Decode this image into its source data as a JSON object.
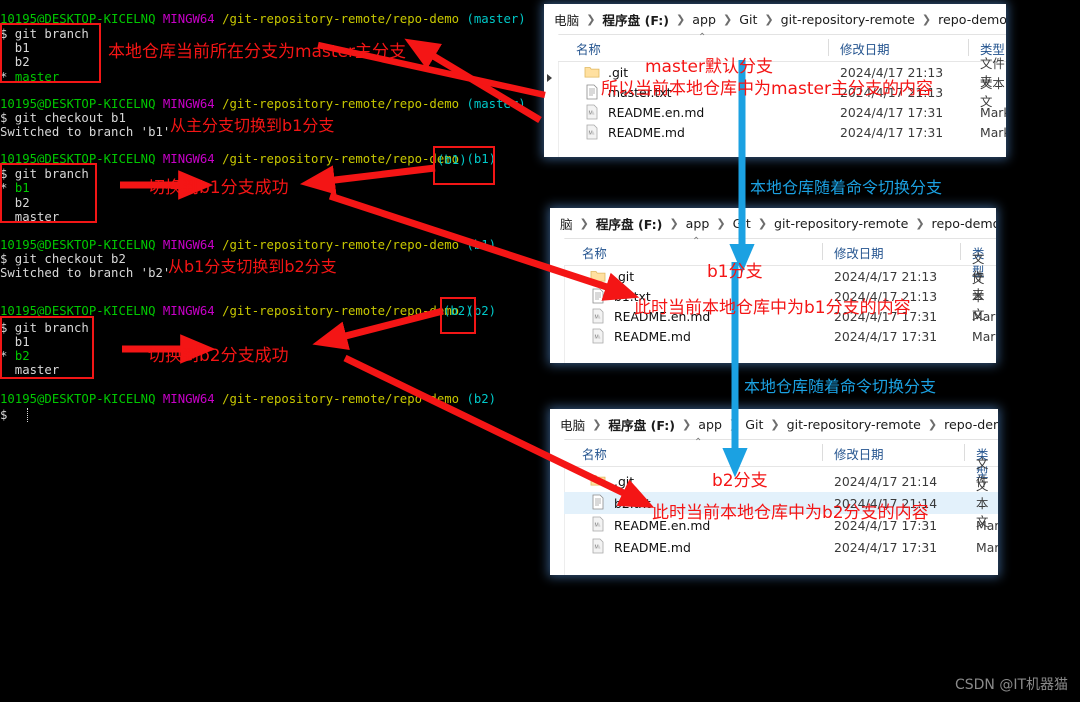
{
  "terminal": {
    "prompt_user": "10195@DESKTOP-KICELNQ",
    "prompt_host": "MINGW64",
    "prompt_path": "/git-repository-remote/repo-demo",
    "blocks": [
      {
        "branch": "(master)",
        "command": "$ git branch",
        "output": [
          "  b1",
          "  b2",
          "* master"
        ],
        "current": "master"
      },
      {
        "branch": "(master)",
        "command": "$ git checkout b1",
        "output": [
          "Switched to branch 'b1'"
        ],
        "current": ""
      },
      {
        "branch": "(b1)",
        "command": "$ git branch",
        "output": [
          "* b1",
          "  b2",
          "  master"
        ],
        "current": "b1"
      },
      {
        "branch": "(b1)",
        "command": "$ git checkout b2",
        "output": [
          "Switched to branch 'b2'"
        ],
        "current": ""
      },
      {
        "branch": "(b2)",
        "command": "$ git branch",
        "output": [
          "  b1",
          "* b2",
          "  master"
        ],
        "current": "b2"
      },
      {
        "branch": "(b2)",
        "command": "$",
        "output": [],
        "current": ""
      }
    ],
    "lines": [
      "10195@DESKTOP-KICELNQ MINGW64 /git-repository-remote/repo-demo (master)",
      "$ git branch",
      "  b1",
      "  b2",
      "* master",
      "10195@DESKTOP-KICELNQ MINGW64 /git-repository-remote/repo-demo (master)",
      "$ git checkout b1",
      "Switched to branch 'b1'",
      "10195@DESKTOP-KICELNQ MINGW64 /git-repository-remote/repo-demo (b1)",
      "$ git branch",
      "* b1",
      "  b2",
      "  master",
      "10195@DESKTOP-KICELNQ MINGW64 /git-repository-remote/repo-demo (b1)",
      "$ git checkout b2",
      "Switched to branch 'b2'",
      "10195@DESKTOP-KICELNQ MINGW64 /git-repository-remote/repo-demo (b2)",
      "$ git branch",
      "  b1",
      "* b2",
      "  master",
      "10195@DESKTOP-KICELNQ MINGW64 /git-repository-remote/repo-demo (b2)",
      "$"
    ],
    "line_texts": {
      "t0_user": "10195@DESKTOP-KICELNQ",
      "t0_host": "MINGW64",
      "t0_path": "/git-repository-remote/repo-demo",
      "t0_branch": "(master)",
      "t1": "$ git branch",
      "t2": "  b1",
      "t3": "  b2",
      "t4_star": "* ",
      "t4_name": "master",
      "t5_branch": "(master)",
      "t6": "$ git checkout b1",
      "t7": "Switched to branch 'b1'",
      "t8_branch": "(b1)",
      "t9": "$ git branch",
      "t10_star": "* ",
      "t10_name": "b1",
      "t11": "  b2",
      "t12": "  master",
      "t13_branch": "(b1)",
      "t14": "$ git checkout b2",
      "t15": "Switched to branch 'b2'",
      "t16_branch": "(b2)",
      "t17": "$ git branch",
      "t18": "  b1",
      "t19_star": "* ",
      "t19_name": "b2",
      "t20": "  master",
      "t21_branch": "(b2)",
      "t22": "$"
    }
  },
  "annotations": {
    "red": [
      "本地仓库当前所在分支为master主分支",
      "从主分支切换到b1分支",
      "切换到b1分支成功",
      "从b1分支切换到b2分支",
      "切换到b2分支成功"
    ],
    "explorer_red": [
      "master默认分支",
      "所以当前本地仓库中为master主分支的内容",
      "b1分支",
      "此时当前本地仓库中为b1分支的内容",
      "b2分支",
      "此时当前本地仓库中为b2分支的内容"
    ],
    "blue": [
      "本地仓库随着命令切换分支",
      "本地仓库随着命令切换分支"
    ],
    "boxed_branch_1": "(b1)",
    "boxed_branch_2": "(b2)"
  },
  "explorers": [
    {
      "breadcrumb": [
        "电脑",
        "程序盘 (F:)",
        "app",
        "Git",
        "git-repository-remote",
        "repo-demo"
      ],
      "columns": {
        "name": "名称",
        "modified": "修改日期",
        "type": "类型"
      },
      "rows": [
        {
          "name": ".git",
          "modified": "2024/4/17 21:13",
          "type": "文件夹",
          "icon": "folder-icon",
          "selected": false
        },
        {
          "name": "master.txt",
          "modified": "2024/4/17 21:13",
          "type": "文本文",
          "icon": "text-file-icon",
          "selected": false
        },
        {
          "name": "README.en.md",
          "modified": "2024/4/17 17:31",
          "type": "Mark",
          "icon": "md-file-icon",
          "selected": false
        },
        {
          "name": "README.md",
          "modified": "2024/4/17 17:31",
          "type": "Mark",
          "icon": "md-file-icon",
          "selected": false
        }
      ]
    },
    {
      "breadcrumb": [
        "脑",
        "程序盘 (F:)",
        "app",
        "Git",
        "git-repository-remote",
        "repo-demo"
      ],
      "columns": {
        "name": "名称",
        "modified": "修改日期",
        "type": "类型"
      },
      "rows": [
        {
          "name": ".git",
          "modified": "2024/4/17 21:13",
          "type": "文件夹",
          "icon": "folder-icon",
          "selected": false
        },
        {
          "name": "b1.txt",
          "modified": "2024/4/17 21:13",
          "type": "文本文",
          "icon": "text-file-icon",
          "selected": false
        },
        {
          "name": "README.en.md",
          "modified": "2024/4/17 17:31",
          "type": "Mark",
          "icon": "md-file-icon",
          "selected": false
        },
        {
          "name": "README.md",
          "modified": "2024/4/17 17:31",
          "type": "Mark",
          "icon": "md-file-icon",
          "selected": false
        }
      ]
    },
    {
      "breadcrumb": [
        "电脑",
        "程序盘 (F:)",
        "app",
        "Git",
        "git-repository-remote",
        "repo-demo"
      ],
      "columns": {
        "name": "名称",
        "modified": "修改日期",
        "type": "类型"
      },
      "rows": [
        {
          "name": ".git",
          "modified": "2024/4/17 21:14",
          "type": "文件夹",
          "icon": "folder-icon",
          "selected": false
        },
        {
          "name": "b2.txt",
          "modified": "2024/4/17 21:14",
          "type": "文本文",
          "icon": "text-file-icon",
          "selected": true
        },
        {
          "name": "README.en.md",
          "modified": "2024/4/17 17:31",
          "type": "Mark",
          "icon": "md-file-icon",
          "selected": false
        },
        {
          "name": "README.md",
          "modified": "2024/4/17 17:31",
          "type": "Mark",
          "icon": "md-file-icon",
          "selected": false
        }
      ]
    }
  ],
  "watermark": "CSDN @IT机器猫",
  "colors": {
    "annotation_red": "#f41515",
    "annotation_blue": "#1ba1e2",
    "terminal_bg": "#000000",
    "prompt_user": "#00c800",
    "prompt_host": "#c800c8",
    "prompt_path": "#c8c800",
    "prompt_branch": "#00c8c8",
    "selection": "#e3f1fb"
  }
}
